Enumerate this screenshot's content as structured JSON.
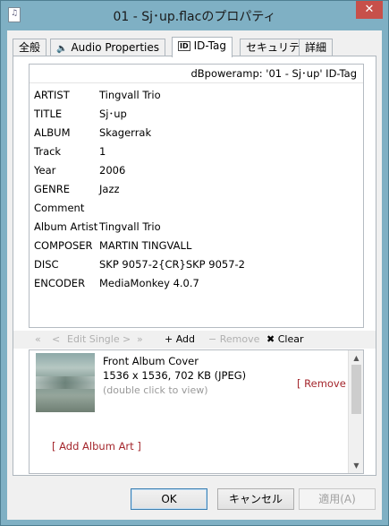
{
  "window": {
    "title": "01 - Sj･up.flacのプロパティ",
    "close_glyph": "✕",
    "app_icon": "music-file-icon"
  },
  "tabs": [
    {
      "label": "全般",
      "icon": ""
    },
    {
      "label": "Audio Properties",
      "icon": "speaker-icon"
    },
    {
      "label": "ID-Tag",
      "icon": "id-tag-icon",
      "icon_text": "ID"
    },
    {
      "label": "セキュリティ",
      "icon": ""
    },
    {
      "label": "詳細",
      "icon": ""
    }
  ],
  "tag": {
    "header": "dBpoweramp: '01 - Sj･up' ID-Tag",
    "fields": [
      {
        "key": "ARTIST",
        "value": "Tingvall Trio"
      },
      {
        "key": "TITLE",
        "value": "Sj･up"
      },
      {
        "key": "ALBUM",
        "value": "Skagerrak"
      },
      {
        "key": "Track",
        "value": "1"
      },
      {
        "key": "Year",
        "value": "2006"
      },
      {
        "key": "GENRE",
        "value": "Jazz"
      },
      {
        "key": "Comment",
        "value": ""
      },
      {
        "key": "Album Artist",
        "value": "Tingvall Trio"
      },
      {
        "key": "COMPOSER",
        "value": "MARTIN TINGVALL"
      },
      {
        "key": "DISC",
        "value": "SKP 9057-2{CR}SKP 9057-2"
      },
      {
        "key": "ENCODER",
        "value": "MediaMonkey 4.0.7"
      }
    ]
  },
  "toolbar": {
    "first": "«",
    "prev": "<",
    "edit_single": "Edit Single",
    "next": ">",
    "last": "»",
    "add": "+ Add",
    "remove": "− Remove",
    "clear": "✖ Clear"
  },
  "art": {
    "title": "Front Album Cover",
    "info": "1536 x 1536, 702 KB  (JPEG)",
    "hint": "(double click to view)",
    "remove_link": "[ Remove ]",
    "add_link": "[ Add Album Art ]",
    "scroll_up": "▲",
    "scroll_down": "▼"
  },
  "buttons": {
    "ok": "OK",
    "cancel": "キャンセル",
    "apply": "適用(A)"
  }
}
